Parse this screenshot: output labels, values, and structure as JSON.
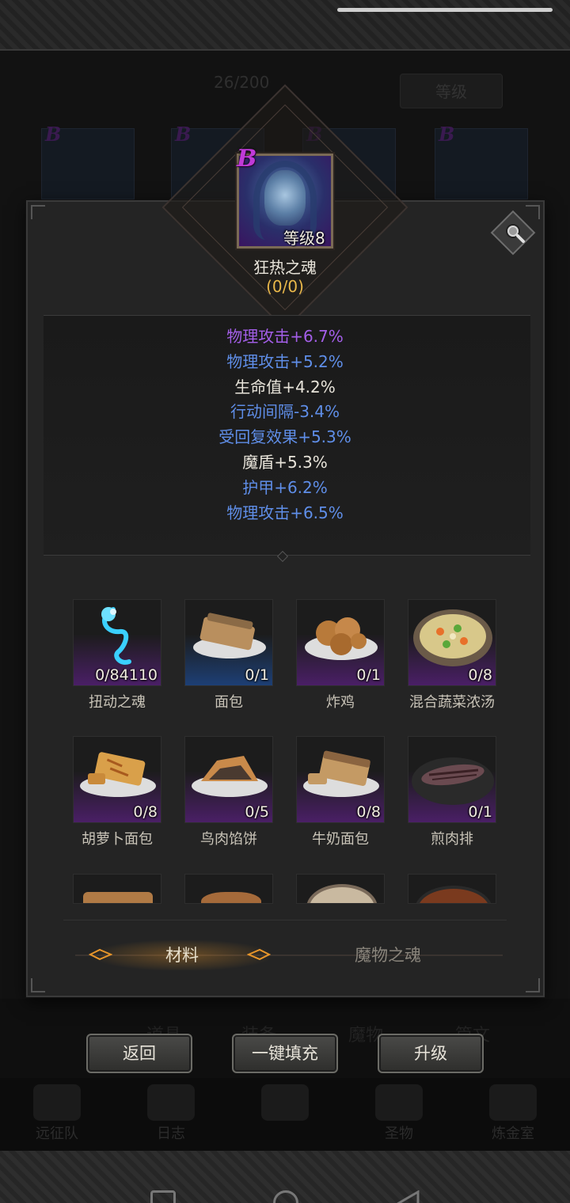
{
  "background": {
    "count": "26/200",
    "level_button": "等级",
    "card_grade": "B",
    "tabs": [
      "道具",
      "装备",
      "魔物",
      "篇文"
    ],
    "nav": [
      "远征队",
      "日志",
      "",
      "圣物",
      "炼金室"
    ]
  },
  "hero": {
    "grade": "B",
    "level_label": "等级8",
    "name": "狂热之魂",
    "count": "(0/0)"
  },
  "stats": [
    {
      "text": "物理攻击+6.7%",
      "color": "#a35ee8"
    },
    {
      "text": "物理攻击+5.2%",
      "color": "#5f8ee8"
    },
    {
      "text": "生命值+4.2%",
      "color": "#e8e4da"
    },
    {
      "text": "行动间隔-3.4%",
      "color": "#5f8ee8"
    },
    {
      "text": "受回复效果+5.3%",
      "color": "#5f8ee8"
    },
    {
      "text": "魔盾+5.3%",
      "color": "#e8e4da"
    },
    {
      "text": "护甲+6.2%",
      "color": "#5f8ee8"
    },
    {
      "text": "物理攻击+6.5%",
      "color": "#5f8ee8"
    }
  ],
  "materials": [
    {
      "name": "扭动之魂",
      "qty": "0/84110",
      "bg": "purple",
      "icon": "blue-spirit-icon"
    },
    {
      "name": "面包",
      "qty": "0/1",
      "bg": "blue",
      "icon": "bread-icon"
    },
    {
      "name": "炸鸡",
      "qty": "0/1",
      "bg": "purple",
      "icon": "fried-chicken-icon"
    },
    {
      "name": "混合蔬菜浓汤",
      "qty": "0/8",
      "bg": "purple",
      "icon": "vegetable-soup-icon"
    },
    {
      "name": "胡萝卜面包",
      "qty": "0/8",
      "bg": "purple",
      "icon": "carrot-bread-icon"
    },
    {
      "name": "鸟肉馅饼",
      "qty": "0/5",
      "bg": "purple",
      "icon": "bird-pie-icon"
    },
    {
      "name": "牛奶面包",
      "qty": "0/8",
      "bg": "purple",
      "icon": "milk-bread-icon"
    },
    {
      "name": "煎肉排",
      "qty": "0/1",
      "bg": "purple",
      "icon": "fried-steak-icon"
    }
  ],
  "tabs": {
    "materials": "材料",
    "souls": "魔物之魂"
  },
  "buttons": {
    "back": "返回",
    "auto_fill": "一键填充",
    "upgrade": "升级"
  }
}
